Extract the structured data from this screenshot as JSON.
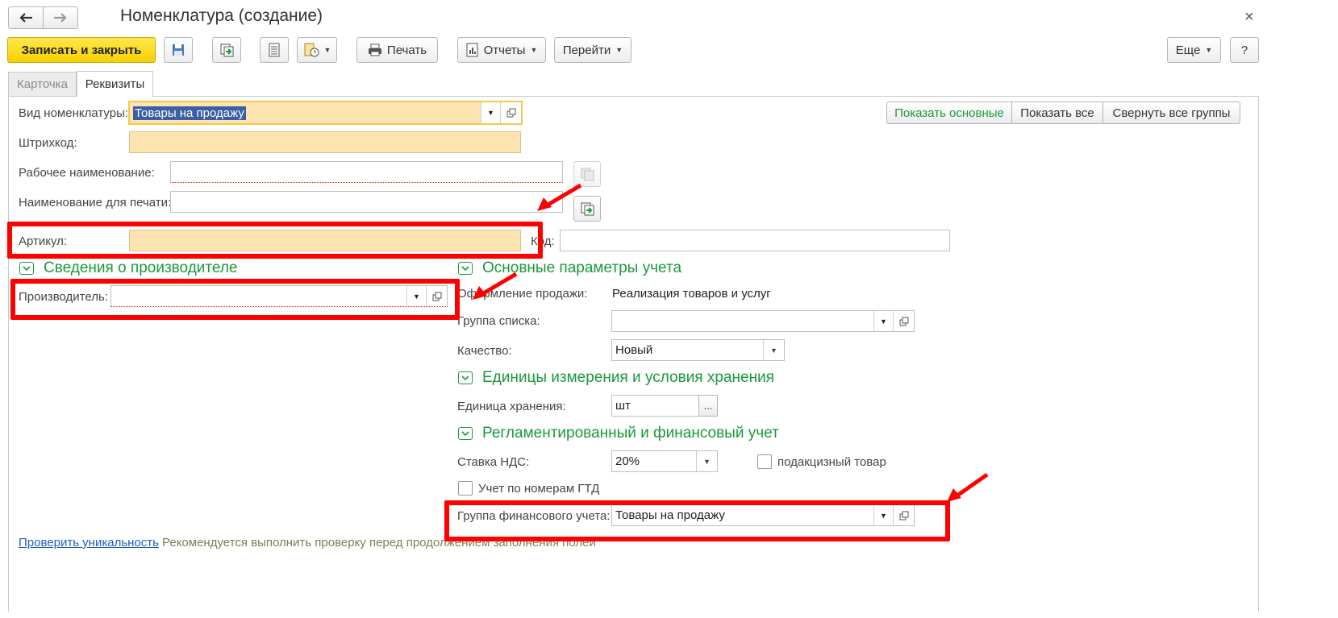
{
  "window": {
    "title": "Номенклатура (создание)"
  },
  "toolbar": {
    "save_close": "Записать и закрыть",
    "print": "Печать",
    "reports": "Отчеты",
    "goto": "Перейти",
    "more": "Еще",
    "help": "?"
  },
  "tabs": [
    "Карточка",
    "Реквизиты"
  ],
  "view_buttons": [
    "Показать основные",
    "Показать все",
    "Свернуть все группы"
  ],
  "form": {
    "vid_label": "Вид номенклатуры:",
    "vid_value": "Товары на продажу",
    "barcode_label": "Штрихкод:",
    "work_name_label": "Рабочее наименование:",
    "print_name_label": "Наименование для печати:",
    "article_label": "Артикул:",
    "code_label": "Код:"
  },
  "manufacturer_group": {
    "title": "Сведения о производителе",
    "producer_label": "Производитель:"
  },
  "accounting_group": {
    "title": "Основные параметры учета",
    "sale_label": "Оформление продажи:",
    "sale_value": "Реализация товаров и услуг",
    "list_group_label": "Группа списка:",
    "quality_label": "Качество:",
    "quality_value": "Новый"
  },
  "units_group": {
    "title": "Единицы измерения и условия хранения",
    "unit_label": "Единица хранения:",
    "unit_value": "шт",
    "ellipsis": "..."
  },
  "finance_group": {
    "title": "Регламентированный и финансовый учет",
    "vat_label": "Ставка НДС:",
    "vat_value": "20%",
    "excise_label": "подакцизный товар",
    "gtd_label": "Учет по номерам ГТД",
    "fin_group_label": "Группа финансового учета:",
    "fin_group_value": "Товары на продажу"
  },
  "footer": {
    "check_link": "Проверить уникальность",
    "hint": "Рекомендуется выполнить проверку перед продолжением заполнения полей"
  },
  "colors": {
    "accent_green": "#1a9a3b",
    "required_fill": "#fde3b0",
    "primary_button": "#f5d000",
    "annotation_red": "#ff0000"
  }
}
